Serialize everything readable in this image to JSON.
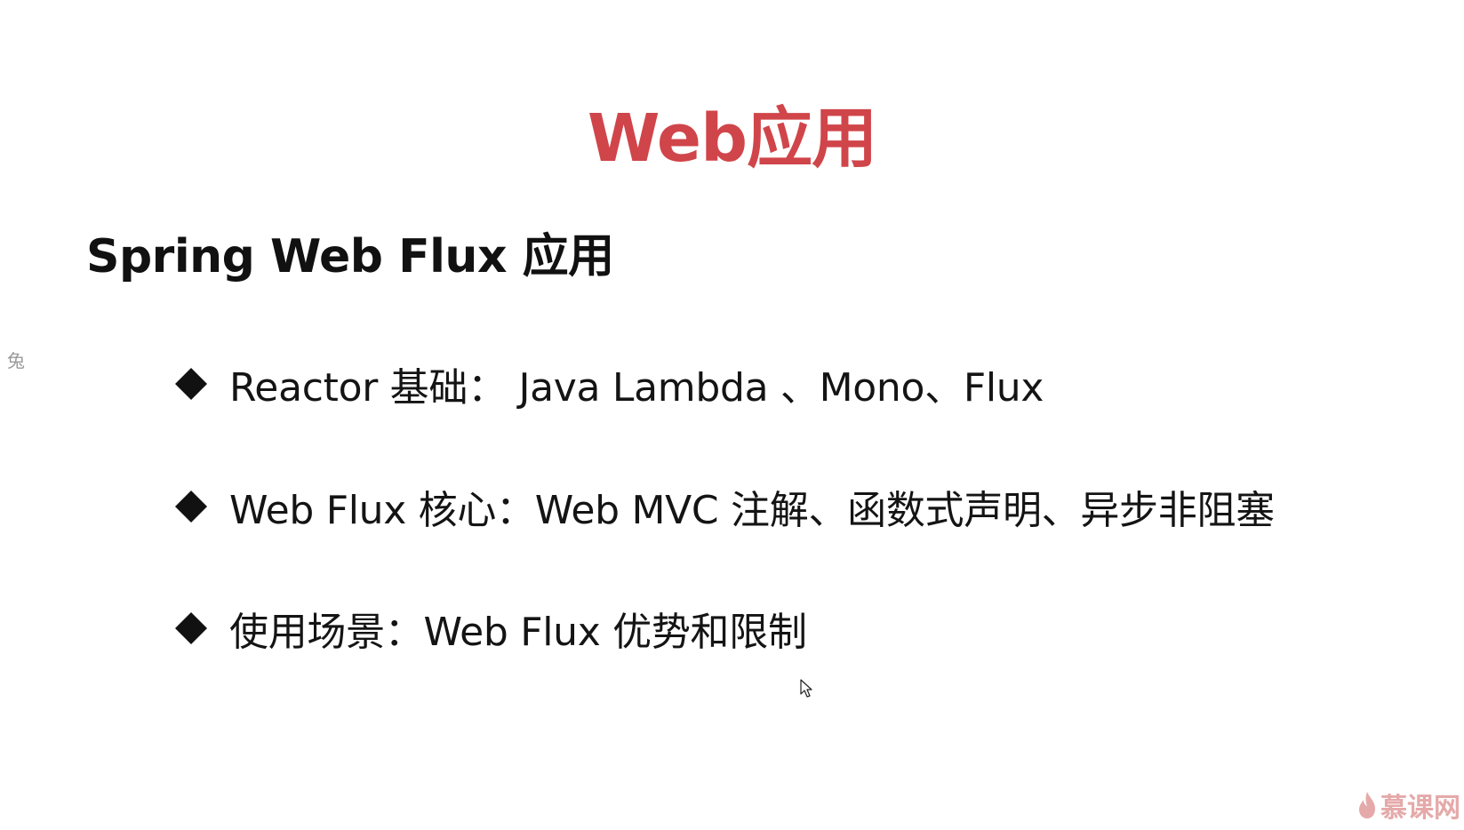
{
  "slide": {
    "title": "Web应用",
    "subtitle": "Spring Web Flux 应用",
    "side_glyph": "兔",
    "bullets": [
      "Reactor 基础： Java Lambda 、Mono、Flux",
      "Web Flux 核心：Web MVC 注解、函数式声明、异步非阻塞",
      "使用场景：Web Flux 优势和限制"
    ],
    "watermark": "慕课网"
  },
  "colors": {
    "title": "#d0454a",
    "text": "#111111",
    "background": "#ffffff",
    "watermark": "#e3a0a0"
  },
  "icons": {
    "bullet": "diamond-icon",
    "cursor": "mouse-pointer-icon",
    "watermark_logo": "flame-icon"
  }
}
